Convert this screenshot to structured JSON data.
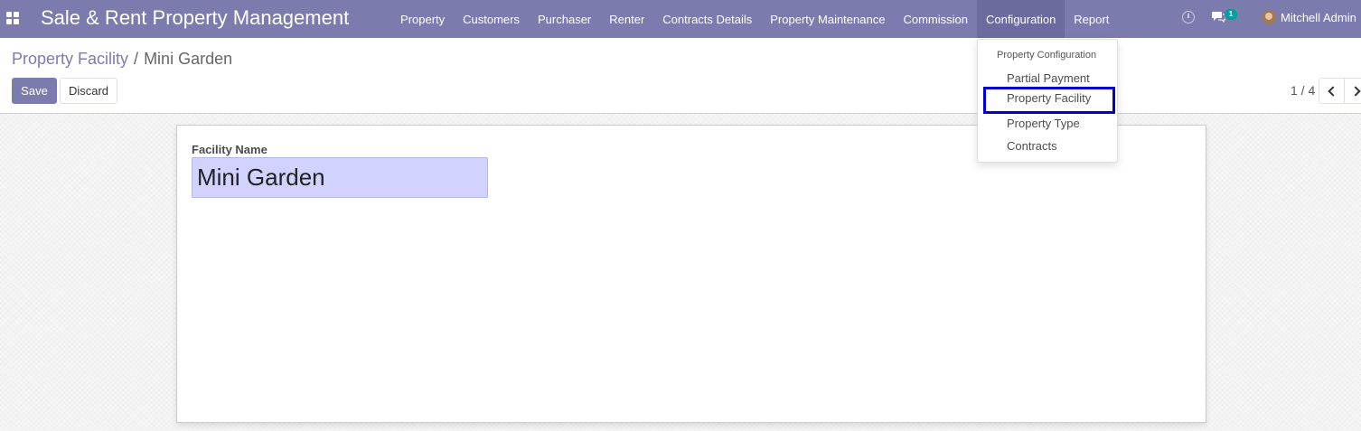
{
  "navbar": {
    "brand": "Sale & Rent Property Management",
    "menu": [
      {
        "label": "Property"
      },
      {
        "label": "Customers"
      },
      {
        "label": "Purchaser"
      },
      {
        "label": "Renter"
      },
      {
        "label": "Contracts Details"
      },
      {
        "label": "Property Maintenance"
      },
      {
        "label": "Commission"
      },
      {
        "label": "Configuration",
        "active": true
      },
      {
        "label": "Report"
      }
    ],
    "chat_badge": "1",
    "user_name": "Mitchell Admin"
  },
  "breadcrumb": {
    "parent": "Property Facility",
    "separator": "/",
    "current": "Mini Garden"
  },
  "buttons": {
    "save": "Save",
    "discard": "Discard"
  },
  "pager": {
    "value": "1 / 4"
  },
  "form": {
    "field_label": "Facility Name",
    "field_value": "Mini Garden"
  },
  "dropdown": {
    "header": "Property Configuration",
    "items": [
      {
        "label": "Partial Payment"
      },
      {
        "label": "Property Facility",
        "highlighted": true
      },
      {
        "label": "Property Type"
      },
      {
        "label": "Contracts"
      }
    ]
  },
  "colors": {
    "navbar": "#7c7bad",
    "primary": "#7c7bad",
    "input_bg": "#d2d2ff",
    "highlight_border": "#0000cc",
    "badge": "#00a09d"
  }
}
